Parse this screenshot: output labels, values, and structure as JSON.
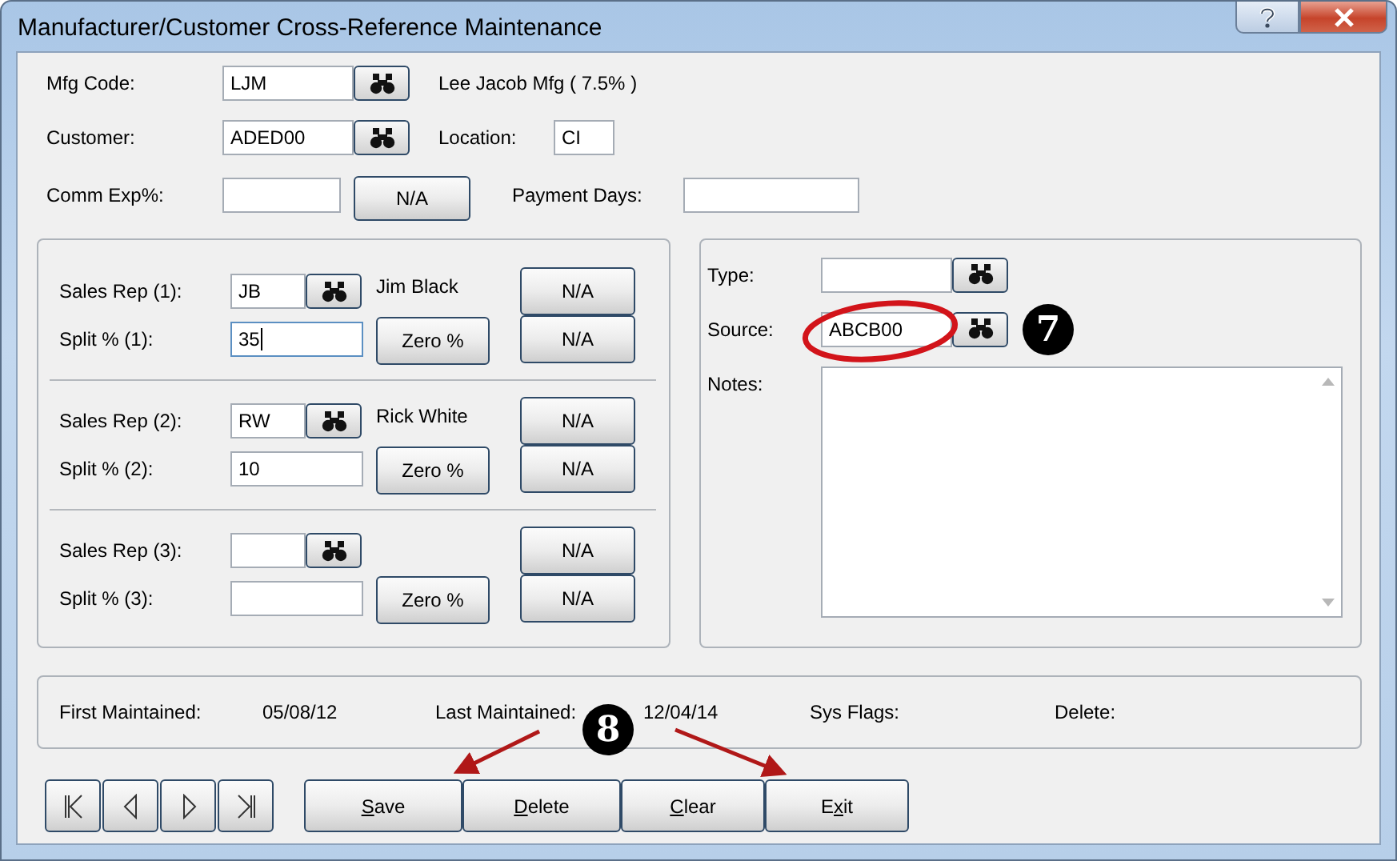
{
  "window": {
    "title": "Manufacturer/Customer Cross-Reference Maintenance"
  },
  "header": {
    "mfg_code": {
      "label": "Mfg Code:",
      "value": "LJM",
      "description": "Lee Jacob Mfg ( 7.5% )"
    },
    "customer": {
      "label": "Customer:",
      "value": "ADED00"
    },
    "location": {
      "label": "Location:",
      "value": "CI"
    },
    "comm_exp": {
      "label": "Comm Exp%:",
      "button": "N/A"
    },
    "payment_days": {
      "label": "Payment Days:"
    }
  },
  "sales_reps": [
    {
      "rep_label": "Sales Rep (1):",
      "rep_code": "JB",
      "rep_name": "Jim Black",
      "rep_button": "N/A",
      "split_label": "Split % (1):",
      "split_value": "35",
      "zero_button": "Zero %",
      "split_button": "N/A",
      "focused": true
    },
    {
      "rep_label": "Sales Rep (2):",
      "rep_code": "RW",
      "rep_name": "Rick White",
      "rep_button": "N/A",
      "split_label": "Split % (2):",
      "split_value": "10",
      "zero_button": "Zero %",
      "split_button": "N/A",
      "focused": false
    },
    {
      "rep_label": "Sales Rep (3):",
      "rep_button": "N/A",
      "split_label": "Split % (3):",
      "zero_button": "Zero %",
      "split_button": "N/A",
      "focused": false
    }
  ],
  "details": {
    "type": {
      "label": "Type:"
    },
    "source": {
      "label": "Source:",
      "value": "ABCB00"
    },
    "notes": {
      "label": "Notes:"
    }
  },
  "maintenance": [
    {
      "label": "First Maintained:",
      "value": "05/08/12"
    },
    {
      "label": "Last Maintained:",
      "value": "12/04/14"
    },
    {
      "label": "Sys Flags:"
    },
    {
      "label": "Delete:"
    }
  ],
  "navigation": [
    {
      "kind": "first"
    },
    {
      "kind": "previous"
    },
    {
      "kind": "next"
    },
    {
      "kind": "last"
    }
  ],
  "actions": [
    {
      "key": "S",
      "rest": "ave"
    },
    {
      "key": "D",
      "rest": "elete"
    },
    {
      "key": "C",
      "rest": "lear"
    },
    {
      "lead": "E",
      "key": "x",
      "rest": "it"
    }
  ],
  "callouts": [
    "7",
    "8"
  ]
}
